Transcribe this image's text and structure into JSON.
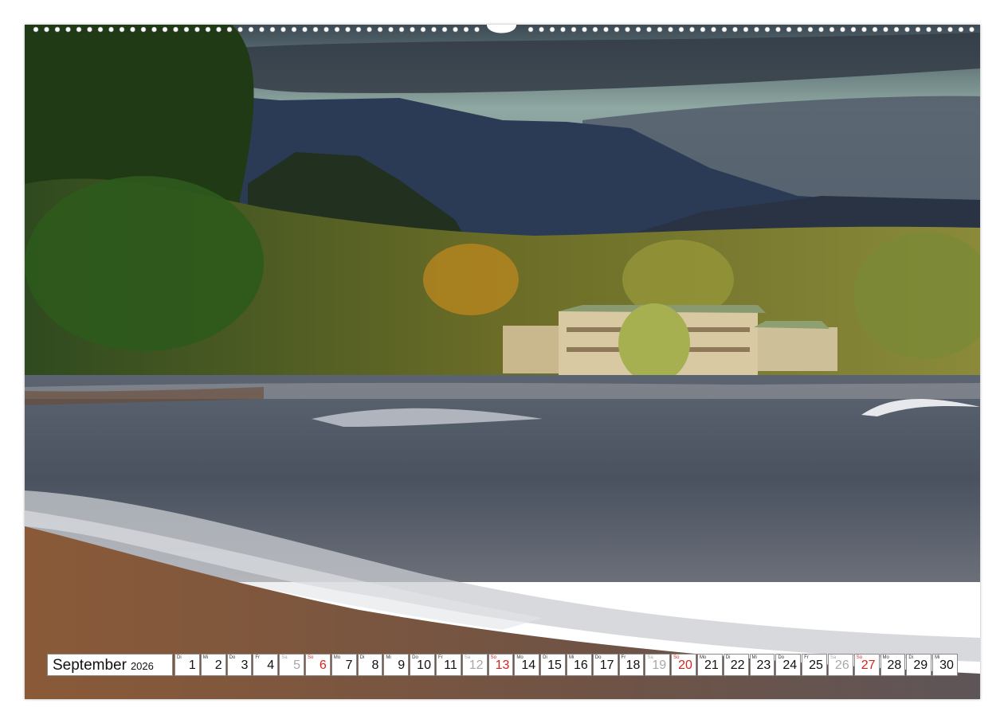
{
  "calendar": {
    "month": "September",
    "year": "2026",
    "days": [
      {
        "wd": "Di",
        "num": "1",
        "type": "weekday"
      },
      {
        "wd": "Mi",
        "num": "2",
        "type": "weekday"
      },
      {
        "wd": "Do",
        "num": "3",
        "type": "weekday"
      },
      {
        "wd": "Fr",
        "num": "4",
        "type": "weekday"
      },
      {
        "wd": "Sa",
        "num": "5",
        "type": "sat"
      },
      {
        "wd": "So",
        "num": "6",
        "type": "sun"
      },
      {
        "wd": "Mo",
        "num": "7",
        "type": "weekday"
      },
      {
        "wd": "Di",
        "num": "8",
        "type": "weekday"
      },
      {
        "wd": "Mi",
        "num": "9",
        "type": "weekday"
      },
      {
        "wd": "Do",
        "num": "10",
        "type": "weekday"
      },
      {
        "wd": "Fr",
        "num": "11",
        "type": "weekday"
      },
      {
        "wd": "Sa",
        "num": "12",
        "type": "sat"
      },
      {
        "wd": "So",
        "num": "13",
        "type": "sun"
      },
      {
        "wd": "Mo",
        "num": "14",
        "type": "weekday"
      },
      {
        "wd": "Di",
        "num": "15",
        "type": "weekday"
      },
      {
        "wd": "Mi",
        "num": "16",
        "type": "weekday"
      },
      {
        "wd": "Do",
        "num": "17",
        "type": "weekday"
      },
      {
        "wd": "Fr",
        "num": "18",
        "type": "weekday"
      },
      {
        "wd": "Sa",
        "num": "19",
        "type": "sat"
      },
      {
        "wd": "So",
        "num": "20",
        "type": "sun"
      },
      {
        "wd": "Mo",
        "num": "21",
        "type": "weekday"
      },
      {
        "wd": "Di",
        "num": "22",
        "type": "weekday"
      },
      {
        "wd": "Mi",
        "num": "23",
        "type": "weekday"
      },
      {
        "wd": "Do",
        "num": "24",
        "type": "weekday"
      },
      {
        "wd": "Fr",
        "num": "25",
        "type": "weekday"
      },
      {
        "wd": "Sa",
        "num": "26",
        "type": "sat"
      },
      {
        "wd": "So",
        "num": "27",
        "type": "sun"
      },
      {
        "wd": "Mo",
        "num": "28",
        "type": "weekday"
      },
      {
        "wd": "Di",
        "num": "29",
        "type": "weekday"
      },
      {
        "wd": "Mi",
        "num": "30",
        "type": "weekday"
      }
    ]
  },
  "colors": {
    "sunday": "#d6241c",
    "saturday": "#a8a8a8",
    "weekday": "#111111"
  }
}
